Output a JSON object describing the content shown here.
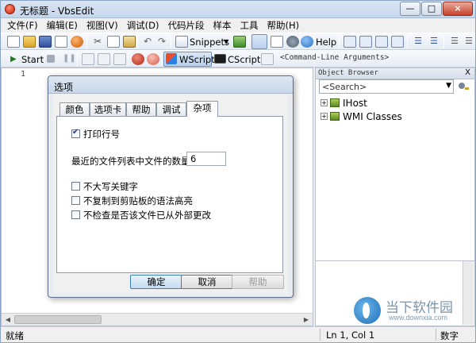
{
  "window": {
    "title": "无标题 - VbsEdit",
    "controls": [
      "—",
      "□",
      "×"
    ]
  },
  "menu": [
    "文件(F)",
    "编辑(E)",
    "视图(V)",
    "调试(D)",
    "代码片段",
    "样本",
    "工具",
    "帮助(H)"
  ],
  "toolbar1": {
    "snippets_label": "Snippets",
    "help_label": "Help"
  },
  "toolbar2": {
    "start_label": "Start",
    "wscript_label": "WScript",
    "cscript_label": "CScript",
    "args_label": "<Command-Line Arguments>"
  },
  "editor": {
    "line_number": "1"
  },
  "object_browser": {
    "title": "Object Browser",
    "close": "X",
    "search_placeholder": "<Search>",
    "items": [
      {
        "label": "IHost",
        "expander": "+"
      },
      {
        "label": "WMI Classes",
        "expander": "+"
      }
    ]
  },
  "status": {
    "left": "就绪",
    "position": "Ln 1, Col 1",
    "mode": "数字"
  },
  "dialog": {
    "title": "选项",
    "tabs": [
      "颜色",
      "选项卡",
      "帮助",
      "调试",
      "杂项"
    ],
    "active_tab": "杂项",
    "print_line_numbers": {
      "label": "打印行号",
      "checked": true
    },
    "recent_files": {
      "label": "最近的文件列表中文件的数量:",
      "value": "6"
    },
    "option_no_uppercase": {
      "label": "不大写关键字",
      "checked": false
    },
    "option_no_copy_syntax": {
      "label": "不复制到剪贴板的语法高亮",
      "checked": false
    },
    "option_no_check_external": {
      "label": "不检查是否该文件已从外部更改",
      "checked": false
    },
    "buttons": {
      "ok": "确定",
      "cancel": "取消",
      "help": "帮助"
    }
  },
  "watermark": {
    "text": "当下软件园",
    "url": "www.downxia.com"
  }
}
